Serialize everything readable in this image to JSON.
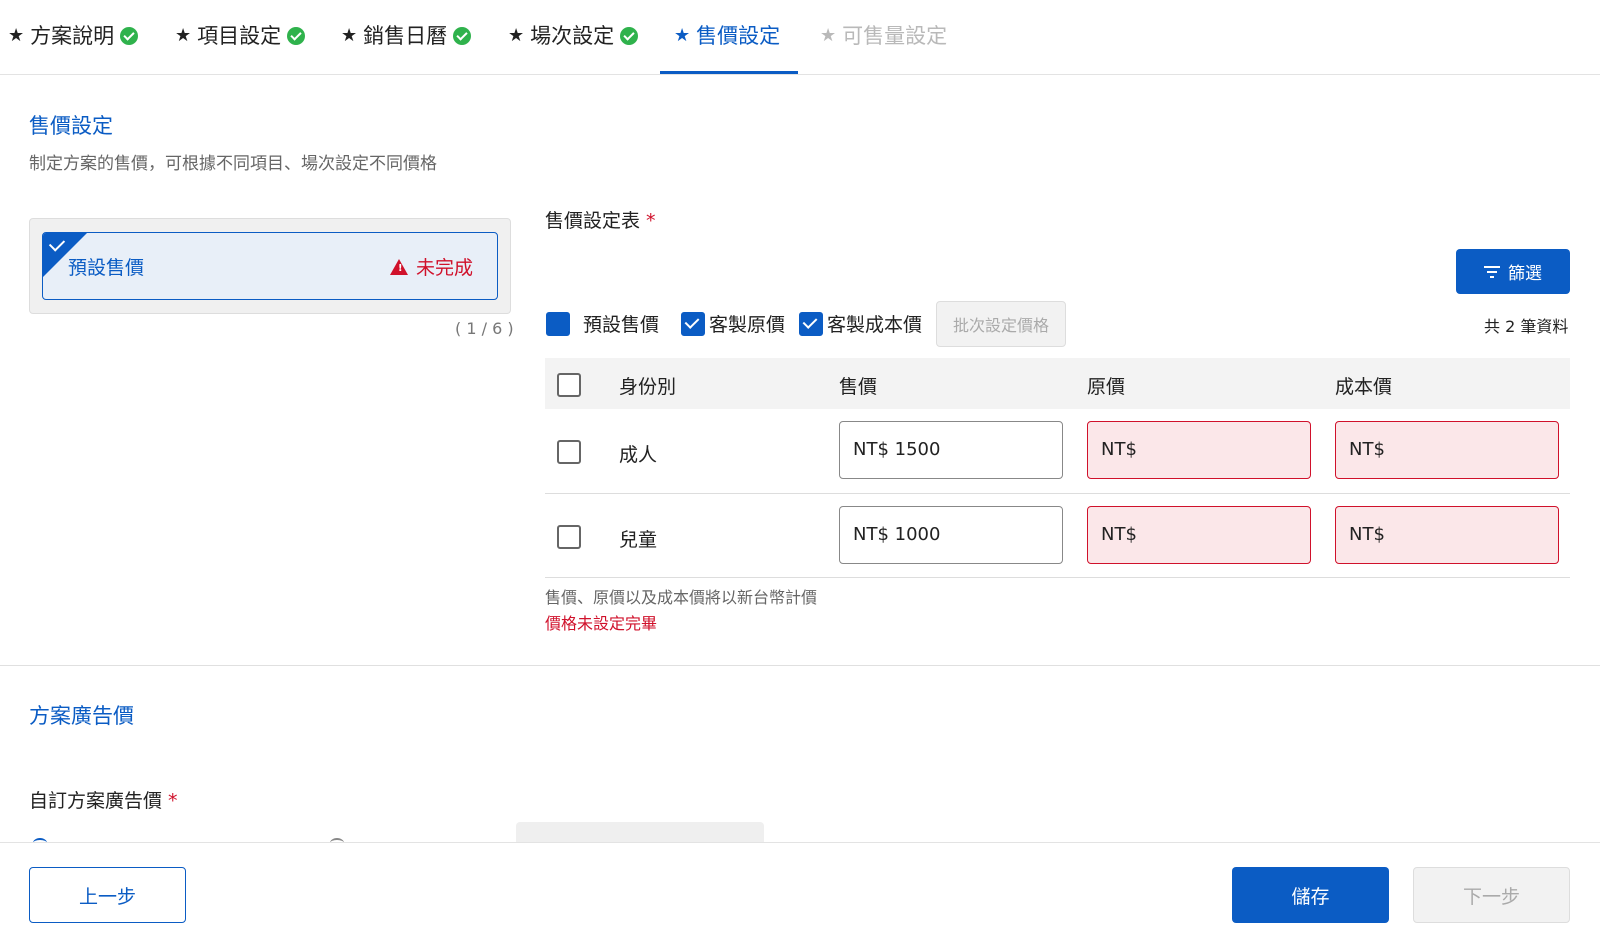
{
  "steps": [
    {
      "label": "方案說明",
      "status": "done"
    },
    {
      "label": "項目設定",
      "status": "done"
    },
    {
      "label": "銷售日曆",
      "status": "done"
    },
    {
      "label": "場次設定",
      "status": "done"
    },
    {
      "label": "售價設定",
      "status": "active"
    },
    {
      "label": "可售量設定",
      "status": "disabled"
    }
  ],
  "price_section": {
    "title": "售價設定",
    "description": "制定方案的售價，可根據不同項目、場次設定不同價格"
  },
  "price_card": {
    "name": "預設售價",
    "status": "未完成",
    "counter": "( 1 / 6 )"
  },
  "price_table": {
    "label": "售價設定表",
    "filter_button": "篩選",
    "options": [
      {
        "label": "預設售價",
        "checked": true
      },
      {
        "label": "客製原價",
        "checked": true
      },
      {
        "label": "客製成本價",
        "checked": true
      }
    ],
    "batch_button": "批次設定價格",
    "total": "共 2 筆資料",
    "headers": [
      "身份別",
      "售價",
      "原價",
      "成本價"
    ],
    "rows": [
      {
        "identity": "成人",
        "price": "NT$ 1500",
        "original": "NT$",
        "cost": "NT$"
      },
      {
        "identity": "兒童",
        "price": "NT$ 1000",
        "original": "NT$",
        "cost": "NT$"
      }
    ],
    "hint": "售價、原價以及成本價將以新台幣計價",
    "error": "價格未設定完畢"
  },
  "ad_section": {
    "title": "方案廣告價",
    "field_label": "自訂方案廣告價"
  },
  "footer": {
    "prev": "上一步",
    "save": "儲存",
    "next": "下一步"
  },
  "colors": {
    "primary": "#0b5cc4",
    "error": "#d0112b",
    "success": "#2fb24c"
  }
}
